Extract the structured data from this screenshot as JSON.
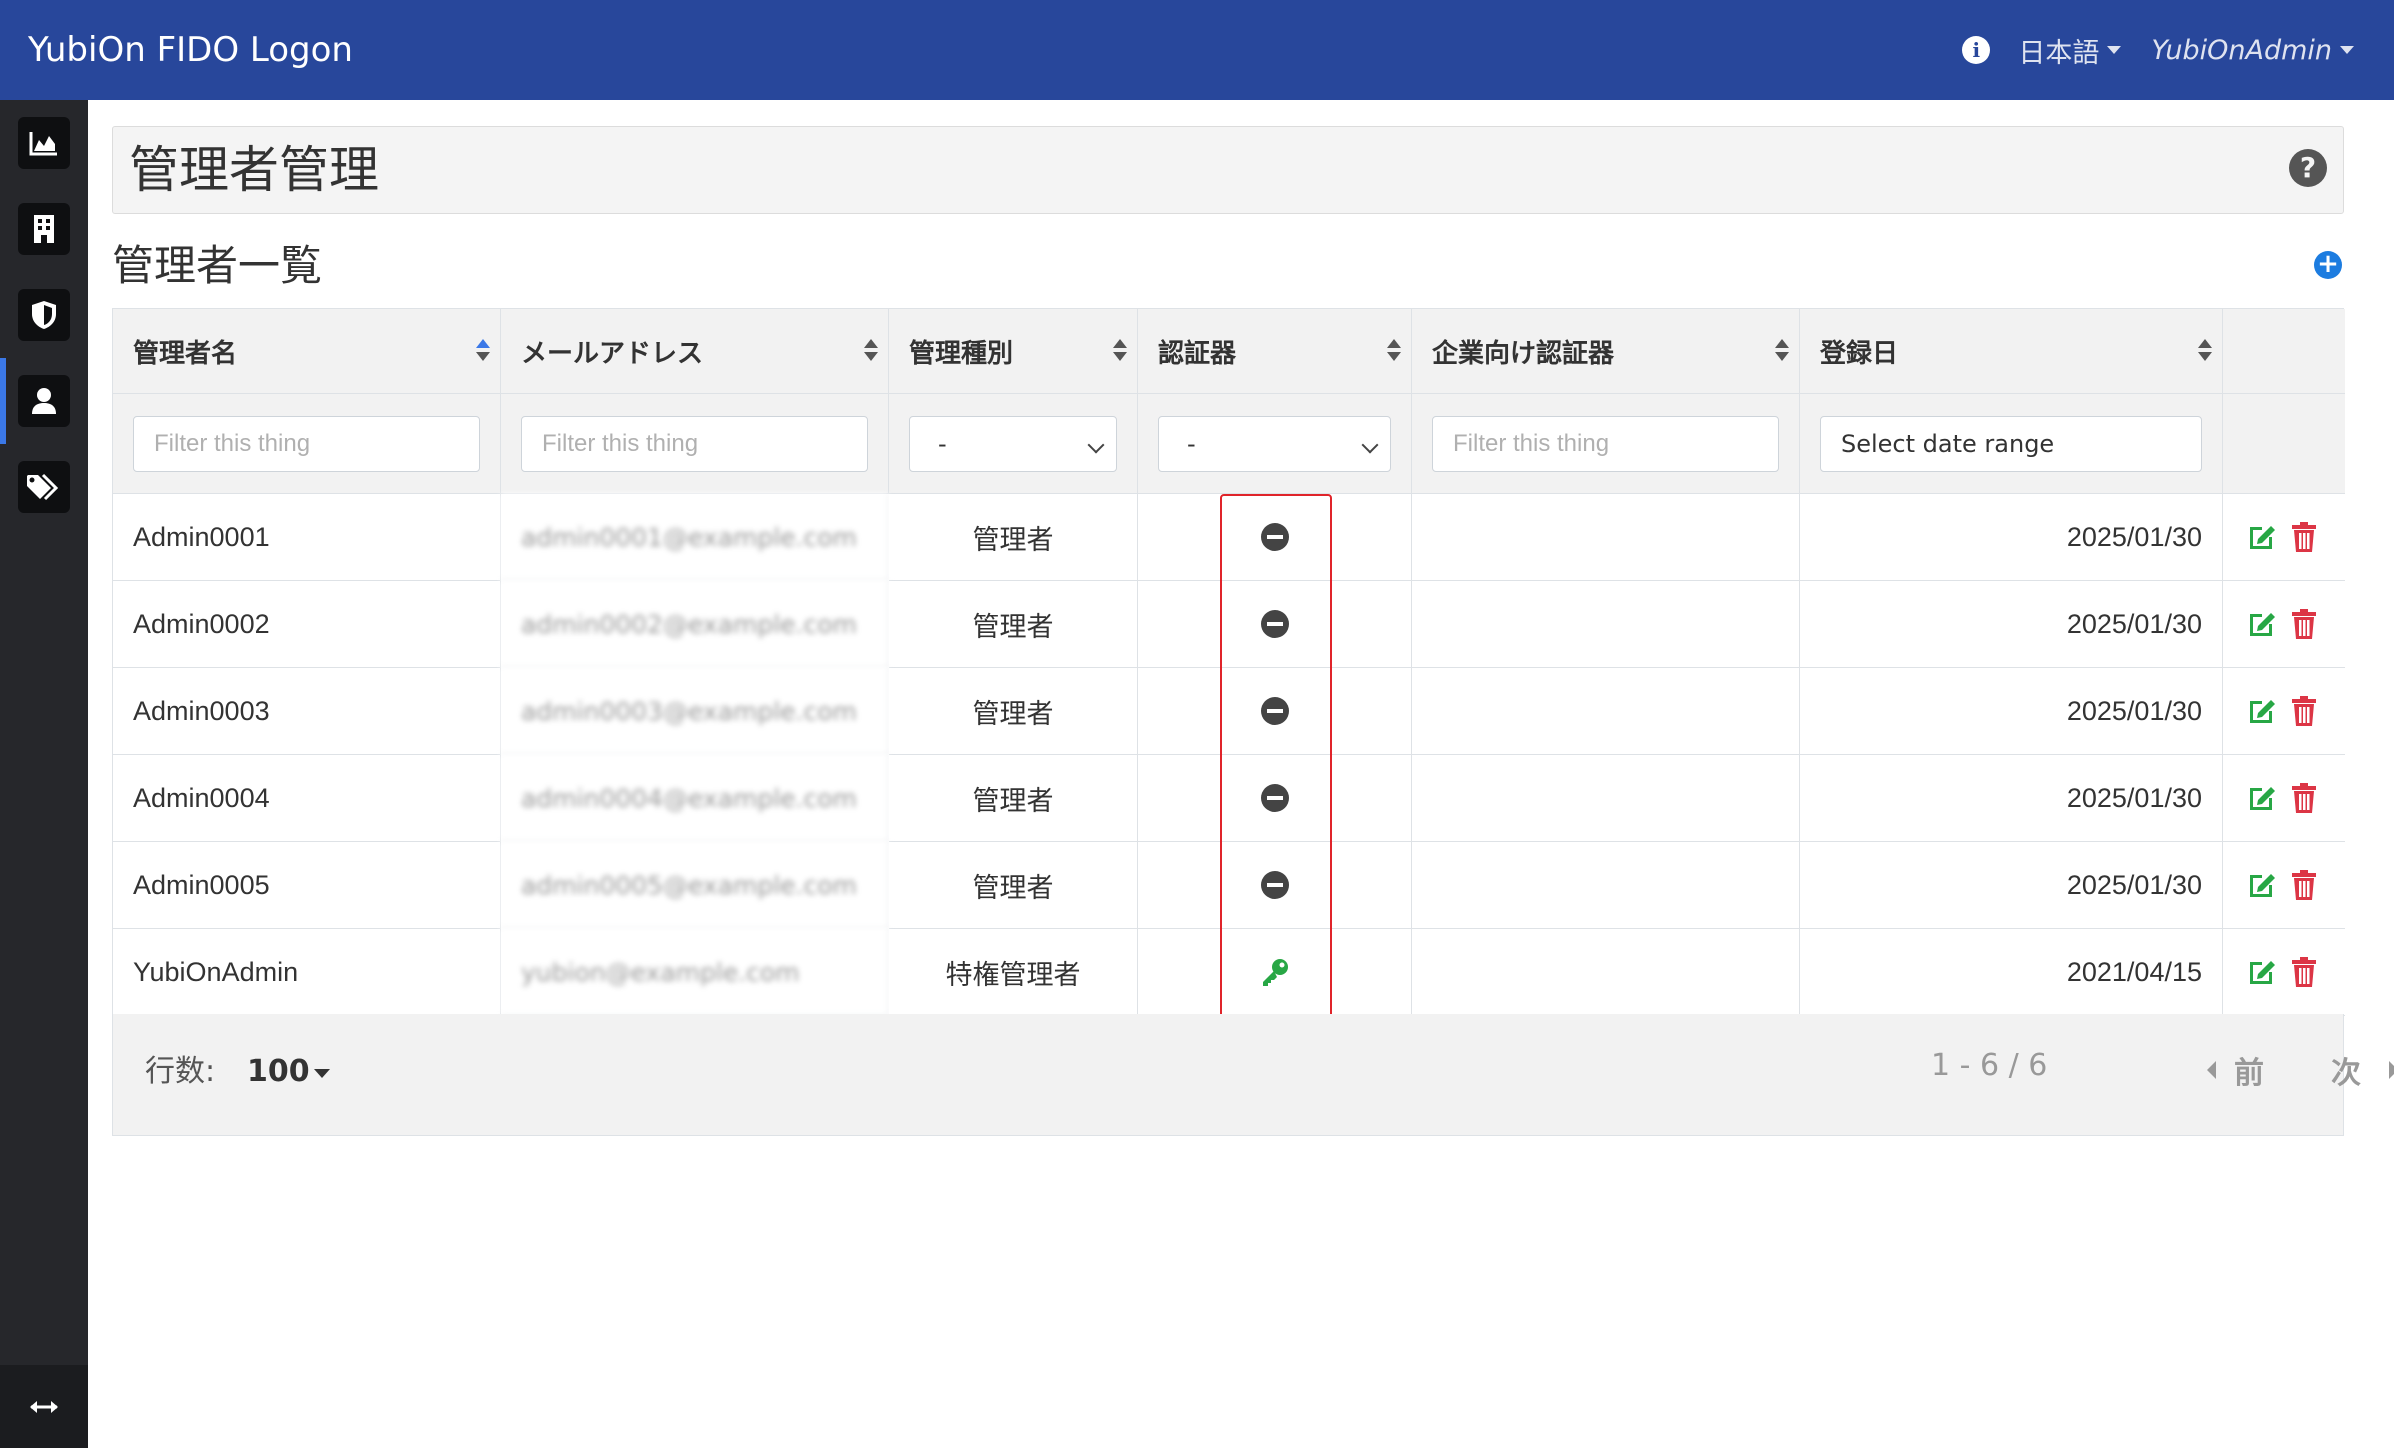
{
  "navbar": {
    "brand": "YubiOn FIDO Logon",
    "language": "日本語",
    "user": "YubiOnAdmin",
    "info_icon": "info-circle-icon"
  },
  "sidebar": {
    "items": [
      {
        "icon": "area-chart-icon",
        "active": false
      },
      {
        "icon": "building-icon",
        "active": false
      },
      {
        "icon": "shield-icon",
        "active": false
      },
      {
        "icon": "user-icon",
        "active": true
      },
      {
        "icon": "tags-icon",
        "active": false
      }
    ],
    "toggle_icon": "arrows-horizontal-icon"
  },
  "page": {
    "title": "管理者管理",
    "help_icon": "question-circle-icon"
  },
  "section": {
    "title": "管理者一覧",
    "add_icon": "plus-circle-icon"
  },
  "table": {
    "columns": [
      "管理者名",
      "メールアドレス",
      "管理種別",
      "認証器",
      "企業向け認証器",
      "登録日"
    ],
    "filters": {
      "name_placeholder": "Filter this thing",
      "email_placeholder": "Filter this thing",
      "type_value": "-",
      "auth_value": "-",
      "enterprise_placeholder": "Filter this thing",
      "date_placeholder": "Select date range"
    },
    "rows": [
      {
        "name": "Admin0001",
        "email": "admin0001@example.com",
        "type": "管理者",
        "authenticator": "none",
        "enterprise": "",
        "date": "2025/01/30"
      },
      {
        "name": "Admin0002",
        "email": "admin0002@example.com",
        "type": "管理者",
        "authenticator": "none",
        "enterprise": "",
        "date": "2025/01/30"
      },
      {
        "name": "Admin0003",
        "email": "admin0003@example.com",
        "type": "管理者",
        "authenticator": "none",
        "enterprise": "",
        "date": "2025/01/30"
      },
      {
        "name": "Admin0004",
        "email": "admin0004@example.com",
        "type": "管理者",
        "authenticator": "none",
        "enterprise": "",
        "date": "2025/01/30"
      },
      {
        "name": "Admin0005",
        "email": "admin0005@example.com",
        "type": "管理者",
        "authenticator": "none",
        "enterprise": "",
        "date": "2025/01/30"
      },
      {
        "name": "YubiOnAdmin",
        "email": "yubion@example.com",
        "type": "特権管理者",
        "authenticator": "key",
        "enterprise": "",
        "date": "2021/04/15"
      }
    ]
  },
  "footer": {
    "rows_label": "行数:",
    "rows_value": "100",
    "range": "1 - 6 / 6",
    "prev": "前",
    "next": "次"
  },
  "colors": {
    "navbar": "#28479b",
    "sidebar": "#26272b",
    "edit": "#28a745",
    "delete": "#dc3545",
    "key": "#28a745",
    "highlight": "#e0242a",
    "add": "#1c7ce0"
  }
}
